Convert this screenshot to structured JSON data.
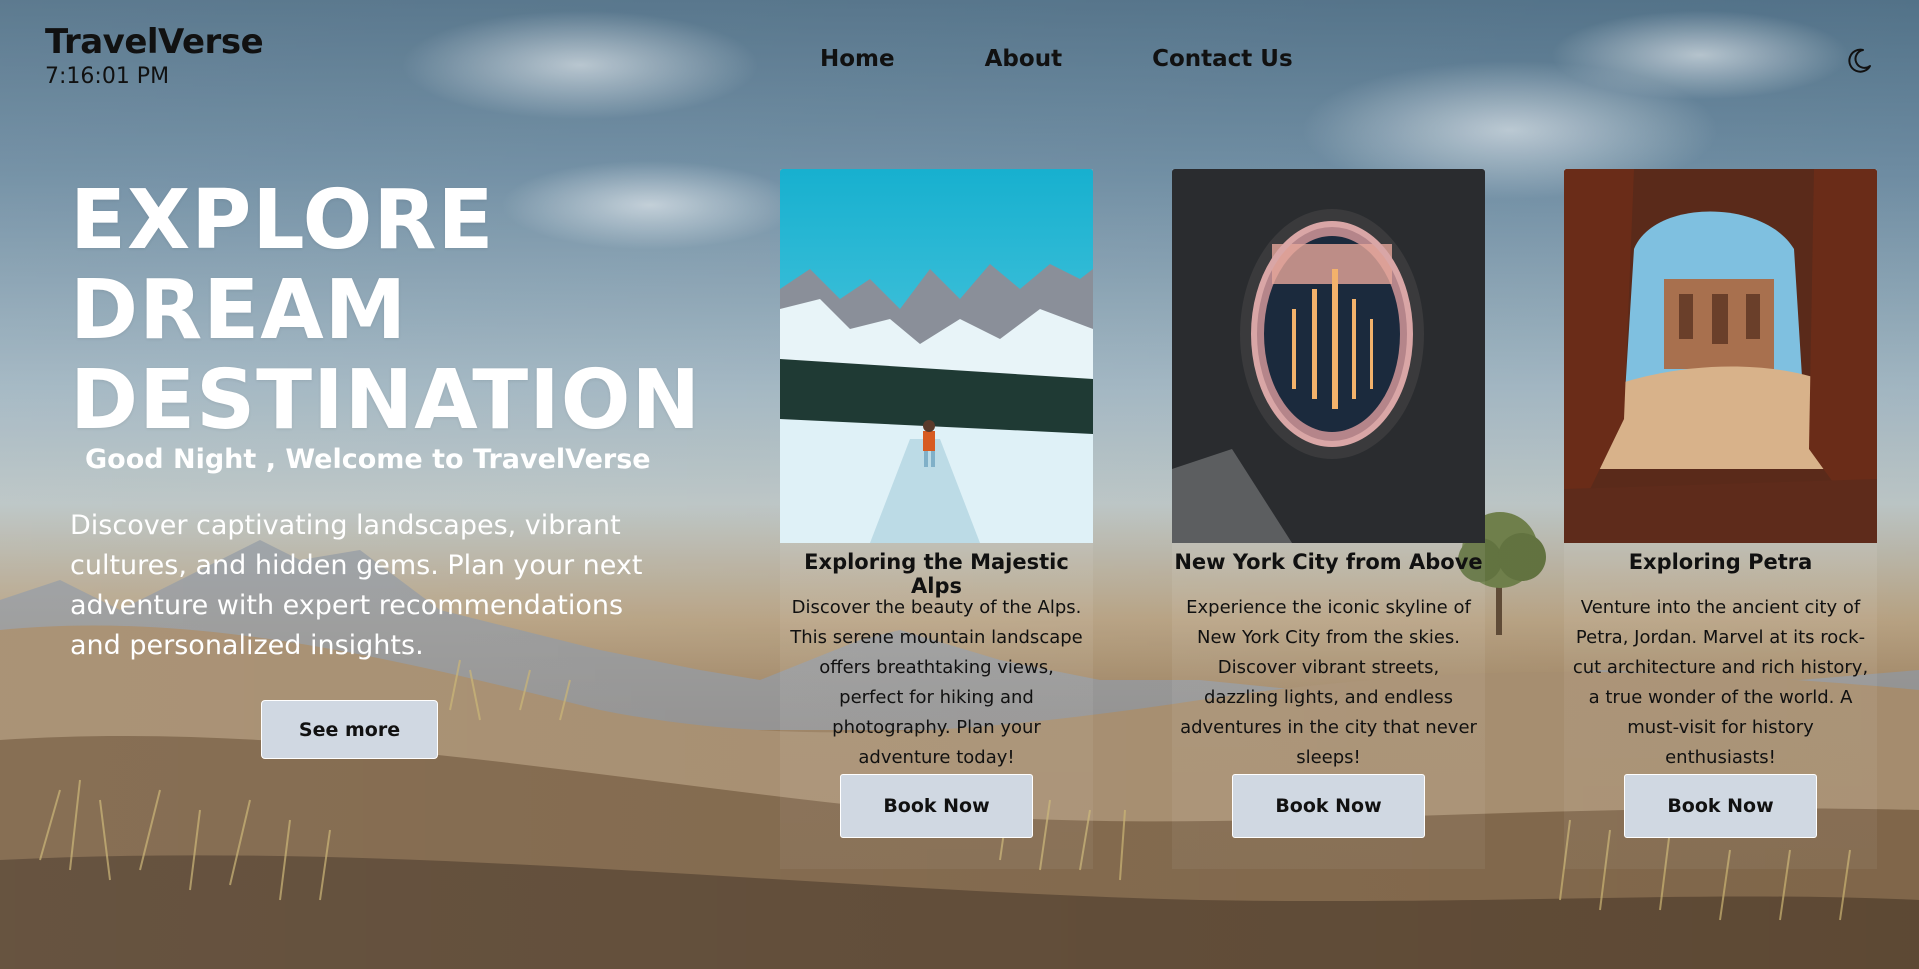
{
  "brand": {
    "name": "TravelVerse",
    "time": "7:16:01 PM"
  },
  "nav": {
    "items": [
      "Home",
      "About",
      "Contact Us"
    ]
  },
  "theme_toggle": {
    "icon": "moon-icon"
  },
  "hero": {
    "title": "EXPLORE\nDREAM\nDESTINATION",
    "greeting": "Good Night , Welcome to TravelVerse",
    "description": "Discover captivating landscapes, vibrant cultures, and hidden gems. Plan your next adventure with expert recommendations and personalized insights.",
    "cta": "See more"
  },
  "cards": [
    {
      "title": "Exploring the Majestic Alps",
      "description": "Discover the beauty of the Alps. This serene mountain landscape offers breathtaking views, perfect for hiking and photography. Plan your adventure today!",
      "button": "Book Now",
      "image": "snowy-mountain-hiker"
    },
    {
      "title": "New York City from Above",
      "description": "Experience the iconic skyline of New York City from the skies. Discover vibrant streets, dazzling lights, and endless adventures in the city that never sleeps!",
      "button": "Book Now",
      "image": "airplane-window-city"
    },
    {
      "title": "Exploring Petra",
      "description": "Venture into the ancient city of Petra, Jordan. Marvel at its rock-cut architecture and rich history, a true wonder of the world. A must-visit for history enthusiasts!",
      "button": "Book Now",
      "image": "petra-monastery"
    }
  ],
  "colors": {
    "button_bg": "#d0d8e2",
    "text_dark": "#111111",
    "hero_text": "#ffffff"
  }
}
